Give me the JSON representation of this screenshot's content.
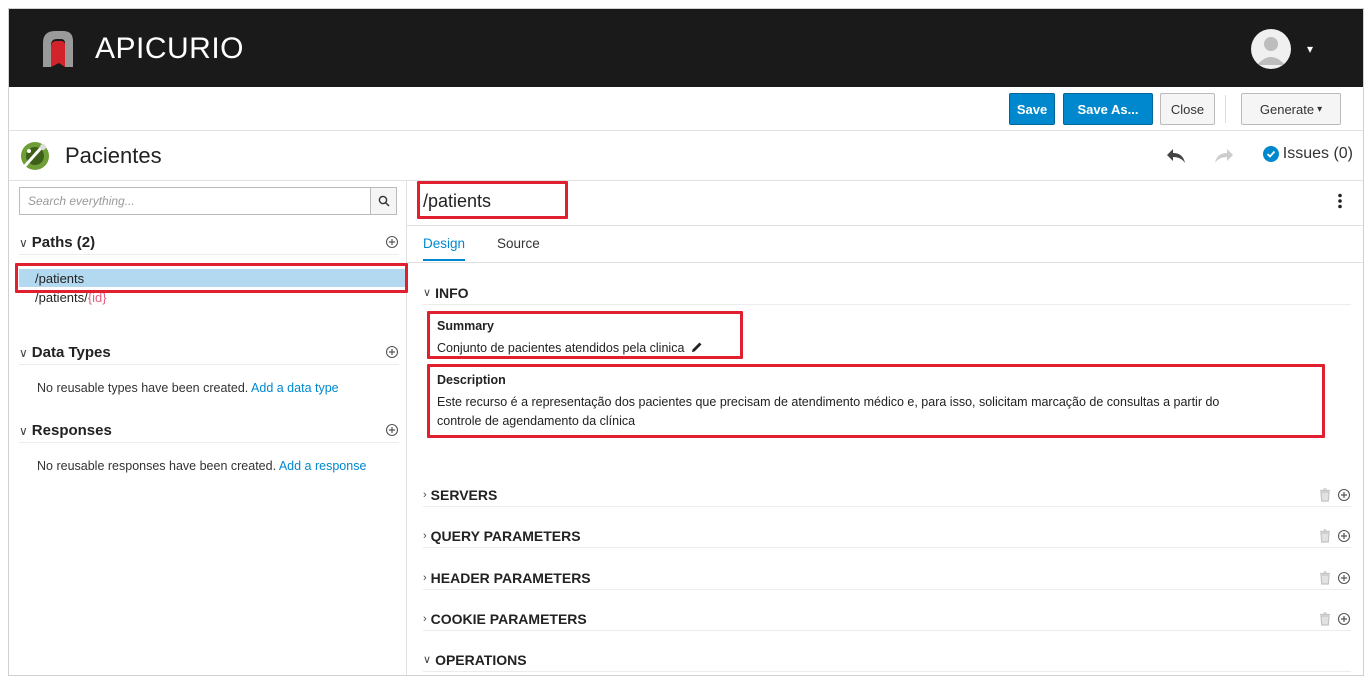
{
  "header": {
    "brand": "APICURIO",
    "user_menu_caret": "▾"
  },
  "toolbar": {
    "save": "Save",
    "save_as": "Save As...",
    "close": "Close",
    "generate": "Generate",
    "generate_caret": "▾"
  },
  "api": {
    "title": "Pacientes",
    "issues_label": "Issues (0)"
  },
  "sidebar": {
    "search_placeholder": "Search everything...",
    "paths_label": "Paths (2)",
    "paths": [
      {
        "base": "/patients",
        "param": ""
      },
      {
        "base": "/patients/",
        "param": "{id}"
      }
    ],
    "data_types_label": "Data Types",
    "data_types_empty": "No reusable types have been created.",
    "data_types_link": "Add a data type",
    "responses_label": "Responses",
    "responses_empty": "No reusable responses have been created.",
    "responses_link": "Add a response"
  },
  "editor": {
    "path": "/patients",
    "tabs": [
      "Design",
      "Source"
    ],
    "info_label": "INFO",
    "summary_label": "Summary",
    "summary_value": "Conjunto de pacientes atendidos pela clinica",
    "description_label": "Description",
    "description_line1": "Este recurso é a representação dos pacientes que precisam de atendimento médico e, para isso, solicitam marcação de consultas a partir do",
    "description_line2": "controle de agendamento da clínica",
    "sections": [
      "SERVERS",
      "QUERY PARAMETERS",
      "HEADER PARAMETERS",
      "COOKIE PARAMETERS"
    ],
    "operations_label": "OPERATIONS"
  },
  "colors": {
    "accent": "#0088ce",
    "highlight": "#e0202f",
    "selected": "#b2d9ef",
    "header_bg": "#1a1a1a"
  }
}
